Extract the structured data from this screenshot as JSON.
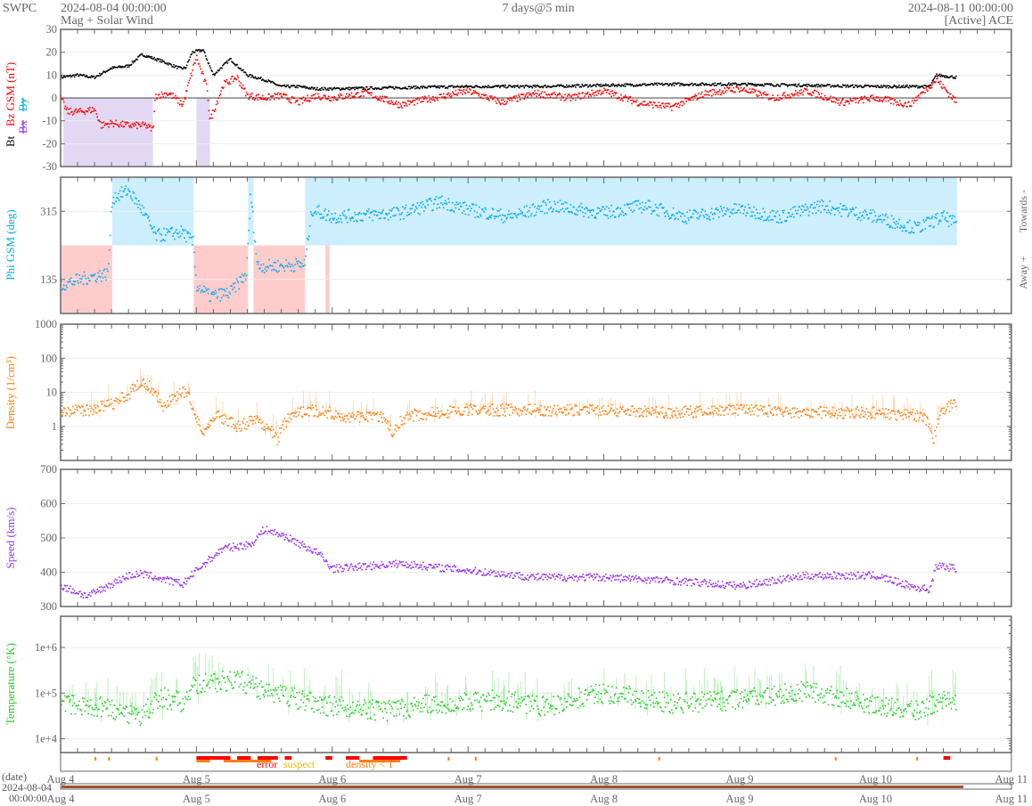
{
  "header": {
    "org": "SWPC",
    "start": "2024-08-04 00:00:00",
    "subtitle": "Mag + Solar Wind",
    "span": "7 days@5 min",
    "end": "2024-08-11 00:00:00",
    "source": "[Active] ACE"
  },
  "colors": {
    "bt": "#000000",
    "bz": "#ff0000",
    "bx": "#9933ff",
    "by": "#00aaff",
    "phi": "#00aaee",
    "towards": "#cdeefc",
    "away": "#ffcccc",
    "density": "#ff7f0e",
    "speed": "#9933ee",
    "temp": "#22cc22",
    "shade": "#e2d8f4"
  },
  "chart_data": [
    {
      "type": "scatter",
      "title": "Bt Bz GSM (nT)",
      "ylabel_parts": {
        "bt": "Bt",
        "bz": "Bz GSM (nT)",
        "bx": "Bx",
        "by": "By"
      },
      "ylim": [
        -30,
        30
      ],
      "yticks": [
        "30",
        "20",
        "10",
        "0",
        "-10",
        "-20",
        "-30"
      ],
      "series": [
        {
          "name": "Bt",
          "points": [
            [
              0,
              9
            ],
            [
              0.125,
              10
            ],
            [
              0.25,
              9
            ],
            [
              0.375,
              13
            ],
            [
              0.5,
              14
            ],
            [
              0.6,
              19
            ],
            [
              0.75,
              16
            ],
            [
              0.875,
              13
            ],
            [
              0.92,
              13
            ],
            [
              0.97,
              20
            ],
            [
              1.05,
              21
            ],
            [
              1.125,
              10
            ],
            [
              1.25,
              17
            ],
            [
              1.375,
              10
            ],
            [
              1.5,
              8
            ],
            [
              1.625,
              5
            ],
            [
              1.75,
              5
            ],
            [
              1.875,
              4
            ],
            [
              2,
              4
            ],
            [
              2.5,
              4.5
            ],
            [
              3,
              5
            ],
            [
              3.5,
              5
            ],
            [
              4,
              5.5
            ],
            [
              4.5,
              6
            ],
            [
              5,
              6
            ],
            [
              5.5,
              5.5
            ],
            [
              6,
              5
            ],
            [
              6.4,
              5
            ],
            [
              6.45,
              10
            ],
            [
              6.6,
              9
            ]
          ]
        },
        {
          "name": "Bz",
          "points": [
            [
              0,
              0
            ],
            [
              0.05,
              -6
            ],
            [
              0.15,
              -6
            ],
            [
              0.25,
              -5
            ],
            [
              0.3,
              -12
            ],
            [
              0.375,
              -11
            ],
            [
              0.5,
              -12
            ],
            [
              0.625,
              -12
            ],
            [
              0.68,
              -14
            ],
            [
              0.7,
              1
            ],
            [
              0.8,
              2
            ],
            [
              0.9,
              -3
            ],
            [
              1.0,
              18
            ],
            [
              1.08,
              4
            ],
            [
              1.1,
              -10
            ],
            [
              1.2,
              6
            ],
            [
              1.3,
              9
            ],
            [
              1.375,
              1
            ],
            [
              1.5,
              0
            ],
            [
              1.625,
              1
            ],
            [
              1.75,
              -2
            ],
            [
              1.875,
              1
            ],
            [
              2,
              0
            ],
            [
              2.25,
              2
            ],
            [
              2.5,
              -3
            ],
            [
              2.75,
              0
            ],
            [
              3,
              3
            ],
            [
              3.25,
              -2
            ],
            [
              3.5,
              2
            ],
            [
              3.75,
              0
            ],
            [
              4,
              3
            ],
            [
              4.25,
              -2
            ],
            [
              4.5,
              -4
            ],
            [
              4.75,
              2
            ],
            [
              5,
              4
            ],
            [
              5.25,
              0
            ],
            [
              5.5,
              3
            ],
            [
              5.75,
              -2
            ],
            [
              6,
              0
            ],
            [
              6.25,
              -3
            ],
            [
              6.45,
              8
            ],
            [
              6.6,
              -2
            ]
          ]
        }
      ],
      "shaded_intervals": [
        [
          0.02,
          0.68
        ],
        [
          1.0,
          1.1
        ]
      ]
    },
    {
      "type": "scatter",
      "title": "Phi GSM (deg)",
      "ylim": [
        45,
        405
      ],
      "yticks": [
        "315",
        "135"
      ],
      "side_labels": {
        "towards": "Towards -",
        "away": "Away +"
      },
      "series": [
        {
          "name": "Phi",
          "points": [
            [
              0,
              120
            ],
            [
              0.2,
              140
            ],
            [
              0.35,
              150
            ],
            [
              0.38,
              350
            ],
            [
              0.5,
              370
            ],
            [
              0.6,
              320
            ],
            [
              0.7,
              250
            ],
            [
              0.9,
              260
            ],
            [
              0.98,
              230
            ],
            [
              1.0,
              120
            ],
            [
              1.1,
              90
            ],
            [
              1.25,
              100
            ],
            [
              1.37,
              150
            ],
            [
              1.4,
              360
            ],
            [
              1.45,
              170
            ],
            [
              1.6,
              170
            ],
            [
              1.8,
              175
            ],
            [
              1.85,
              320
            ],
            [
              2,
              300
            ],
            [
              2.5,
              310
            ],
            [
              2.8,
              340
            ],
            [
              3.0,
              320
            ],
            [
              3.3,
              300
            ],
            [
              3.6,
              330
            ],
            [
              4,
              310
            ],
            [
              4.3,
              330
            ],
            [
              4.6,
              300
            ],
            [
              5,
              320
            ],
            [
              5.3,
              300
            ],
            [
              5.6,
              330
            ],
            [
              6,
              300
            ],
            [
              6.3,
              270
            ],
            [
              6.5,
              300
            ],
            [
              6.6,
              280
            ]
          ]
        }
      ],
      "sector_intervals": {
        "towards": [
          [
            0.38,
            0.98
          ],
          [
            1.38,
            1.42
          ],
          [
            1.8,
            6.6
          ]
        ],
        "away": [
          [
            0,
            0.38
          ],
          [
            0.98,
            1.38
          ],
          [
            1.42,
            1.8
          ],
          [
            1.95,
            1.98
          ]
        ]
      }
    },
    {
      "type": "scatter",
      "title": "Density (1/cm³)",
      "yscale": "log",
      "ylim": [
        0.1,
        1000
      ],
      "yticks": [
        "1000",
        "100",
        "10",
        "1"
      ],
      "series": [
        {
          "name": "Density",
          "points": [
            [
              0,
              3
            ],
            [
              0.25,
              3
            ],
            [
              0.4,
              5
            ],
            [
              0.5,
              8
            ],
            [
              0.6,
              20
            ],
            [
              0.65,
              15
            ],
            [
              0.75,
              3
            ],
            [
              0.9,
              10
            ],
            [
              1.0,
              2
            ],
            [
              1.05,
              0.5
            ],
            [
              1.15,
              2
            ],
            [
              1.3,
              1
            ],
            [
              1.45,
              1.5
            ],
            [
              1.6,
              0.4
            ],
            [
              1.7,
              2
            ],
            [
              1.85,
              3
            ],
            [
              2.1,
              2
            ],
            [
              2.35,
              2
            ],
            [
              2.45,
              0.6
            ],
            [
              2.55,
              2
            ],
            [
              3,
              3
            ],
            [
              3.5,
              3
            ],
            [
              4,
              3
            ],
            [
              4.5,
              2.5
            ],
            [
              5,
              3
            ],
            [
              5.5,
              2.5
            ],
            [
              6,
              2.5
            ],
            [
              6.35,
              2
            ],
            [
              6.43,
              0.2
            ],
            [
              6.5,
              3
            ],
            [
              6.6,
              5
            ]
          ]
        }
      ]
    },
    {
      "type": "scatter",
      "title": "Speed (km/s)",
      "ylim": [
        300,
        700
      ],
      "yticks": [
        "700",
        "600",
        "500",
        "400",
        "300"
      ],
      "series": [
        {
          "name": "Speed",
          "points": [
            [
              0,
              360
            ],
            [
              0.2,
              330
            ],
            [
              0.35,
              360
            ],
            [
              0.5,
              390
            ],
            [
              0.6,
              395
            ],
            [
              0.9,
              365
            ],
            [
              1.0,
              405
            ],
            [
              1.2,
              470
            ],
            [
              1.4,
              480
            ],
            [
              1.5,
              525
            ],
            [
              1.65,
              505
            ],
            [
              1.9,
              455
            ],
            [
              2.0,
              410
            ],
            [
              2.5,
              425
            ],
            [
              3.0,
              405
            ],
            [
              3.5,
              385
            ],
            [
              4.0,
              385
            ],
            [
              4.5,
              375
            ],
            [
              5.0,
              360
            ],
            [
              5.5,
              390
            ],
            [
              6.0,
              390
            ],
            [
              6.3,
              355
            ],
            [
              6.4,
              350
            ],
            [
              6.45,
              420
            ],
            [
              6.6,
              410
            ]
          ]
        }
      ]
    },
    {
      "type": "scatter",
      "title": "Temperature (°K)",
      "yscale": "log",
      "ylim": [
        5000,
        4800000
      ],
      "yticks": [
        "1e+6",
        "1e+5",
        "1e+4"
      ],
      "series": [
        {
          "name": "Temperature",
          "points": [
            [
              0,
              60000
            ],
            [
              0.3,
              50000
            ],
            [
              0.6,
              30000
            ],
            [
              0.75,
              80000
            ],
            [
              0.9,
              60000
            ],
            [
              1.0,
              150000
            ],
            [
              1.3,
              200000
            ],
            [
              1.5,
              100000
            ],
            [
              2.0,
              50000
            ],
            [
              2.4,
              40000
            ],
            [
              2.8,
              60000
            ],
            [
              3.2,
              70000
            ],
            [
              3.6,
              50000
            ],
            [
              4.0,
              100000
            ],
            [
              4.5,
              60000
            ],
            [
              5.0,
              70000
            ],
            [
              5.5,
              110000
            ],
            [
              6.0,
              50000
            ],
            [
              6.3,
              40000
            ],
            [
              6.5,
              70000
            ]
          ]
        }
      ]
    },
    {
      "type": "table",
      "title": "quality flags",
      "legend": {
        "error": "error",
        "suspect": "suspect",
        "density": "density < 1"
      },
      "error_intervals": [
        [
          1.0,
          1.25
        ],
        [
          1.3,
          1.4
        ],
        [
          1.45,
          1.6
        ],
        [
          1.65,
          1.7
        ],
        [
          1.95,
          2.0
        ],
        [
          2.1,
          2.2
        ],
        [
          2.3,
          2.55
        ],
        [
          6.5,
          6.55
        ]
      ],
      "density_intervals": [
        [
          1.0,
          1.1
        ],
        [
          1.2,
          1.55
        ],
        [
          2.2,
          2.5
        ]
      ],
      "isolated": [
        0.25,
        0.35,
        0.7,
        2.85,
        3.05,
        4.4,
        5.7,
        6.3
      ]
    }
  ],
  "xaxis": {
    "label": "(date)",
    "start_date": "2024-08-04",
    "start_time": "00:00:00",
    "ticks": [
      "Aug 4",
      "Aug 5",
      "Aug 6",
      "Aug 7",
      "Aug 8",
      "Aug 9",
      "Aug 10",
      "Aug 11"
    ]
  }
}
